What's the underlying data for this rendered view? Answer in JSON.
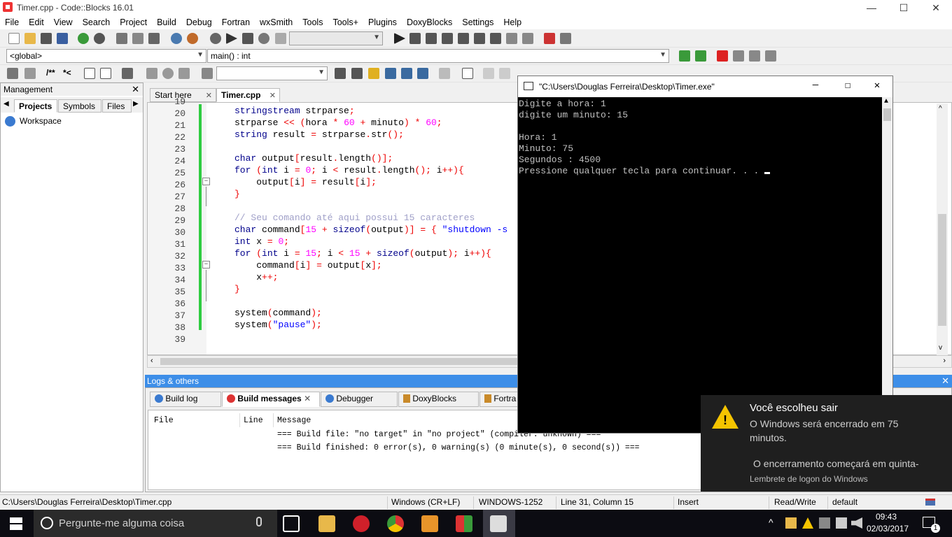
{
  "window": {
    "title": "Timer.cpp - Code::Blocks 16.01",
    "minimize": "—",
    "maximize": "☐",
    "close": "✕"
  },
  "menu": [
    "File",
    "Edit",
    "View",
    "Search",
    "Project",
    "Build",
    "Debug",
    "Fortran",
    "wxSmith",
    "Tools",
    "Tools+",
    "Plugins",
    "DoxyBlocks",
    "Settings",
    "Help"
  ],
  "toolbar2": {
    "scope": "<global>",
    "function": "main() : int"
  },
  "toolbar3": {
    "comment_block": "/**",
    "comment_line": "*<"
  },
  "management": {
    "title": "Management",
    "close": "✕",
    "tabs": [
      "Projects",
      "Symbols",
      "Files"
    ],
    "workspace": "Workspace"
  },
  "editor": {
    "tabs": [
      {
        "label": "Start here",
        "close": "✕"
      },
      {
        "label": "Timer.cpp",
        "close": "✕"
      }
    ],
    "line_numbers": [
      "19",
      "20",
      "21",
      "22",
      "23",
      "24",
      "25",
      "26",
      "27",
      "28",
      "29",
      "30",
      "31",
      "32",
      "33",
      "34",
      "35",
      "36",
      "37",
      "38",
      "39"
    ]
  },
  "logs": {
    "title": "Logs & others",
    "close": "✕",
    "tabs": [
      "Build log",
      "Build messages",
      "Debugger",
      "DoxyBlocks",
      "Fortra"
    ],
    "columns": [
      "File",
      "Line",
      "Message"
    ],
    "lines": [
      "=== Build file: \"no target\" in \"no project\" (compiler: unknown) ===",
      "=== Build finished: 0 error(s), 0 warning(s) (0 minute(s), 0 second(s)) ==="
    ]
  },
  "statusbar": {
    "path": "C:\\Users\\Douglas Ferreira\\Desktop\\Timer.cpp",
    "eol": "Windows (CR+LF)",
    "encoding": "WINDOWS-1252",
    "position": "Line 31, Column 15",
    "mode": "Insert",
    "access": "Read/Write",
    "lang": "default"
  },
  "console": {
    "title": "\"C:\\Users\\Douglas Ferreira\\Desktop\\Timer.exe\"",
    "lines": [
      "Digite a hora: 1",
      "digite um minuto: 15",
      "",
      "Hora: 1",
      "Minuto: 75",
      "Segundos : 4500",
      "Pressione qualquer tecla para continuar. . . "
    ]
  },
  "toast": {
    "title": "Você escolheu sair",
    "body": "O Windows será encerrado em 75 minutos.",
    "detail": "O encerramento começará em quinta-",
    "source": "Lembrete de logon do Windows"
  },
  "taskbar": {
    "search_placeholder": "Pergunte-me alguma coisa",
    "time": "09:43",
    "date": "02/03/2017",
    "notifications": "1"
  },
  "colors": {
    "keyword": "#00008b",
    "operator": "#e00000",
    "number": "#ff00ff",
    "string": "#0000ff",
    "comment": "#a0a0c8",
    "change_bar": "#2ecc40",
    "logs_header": "#3d8ee8"
  }
}
